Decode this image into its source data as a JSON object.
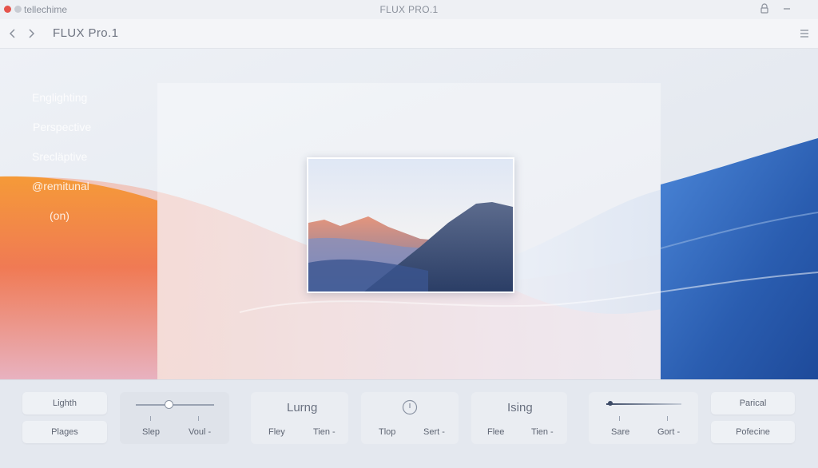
{
  "titlebar": {
    "app_name": "tellechime",
    "title": "FLUX PRO.1"
  },
  "toolbar": {
    "doc_title": "FLUX Pro.1"
  },
  "sidebar": {
    "items": [
      {
        "label": "Englighting"
      },
      {
        "label": "Perspective"
      },
      {
        "label": "Srecläptive"
      },
      {
        "label": "@remitunal"
      },
      {
        "label": "(on)"
      }
    ]
  },
  "bottom": {
    "btn_1": "Lighth",
    "btn_2": "Plages",
    "slider_1": {
      "value": 0.42,
      "label_a": "Slep",
      "label_b": "Voul -"
    },
    "group_3": {
      "title": "Lurng",
      "label_a": "Fley",
      "label_b": "Tien -"
    },
    "group_4": {
      "label_a": "Tlop",
      "label_b": "Sert -"
    },
    "group_5": {
      "title": "Ising",
      "label_a": "Flee",
      "label_b": "Tien -"
    },
    "slider_2": {
      "value": 0.05,
      "label_a": "Sare",
      "label_b": "Gort -"
    },
    "btn_3": "Parical",
    "btn_4": "Pofecine"
  },
  "colors": {
    "accent_orange": "#f3862f",
    "accent_blue": "#2a5db0",
    "close_dot": "#e5534b"
  },
  "icons": [
    "back-arrow-icon",
    "forward-arrow-icon",
    "lock-icon",
    "minimize-icon",
    "hamburger-menu-icon",
    "clock-icon"
  ]
}
